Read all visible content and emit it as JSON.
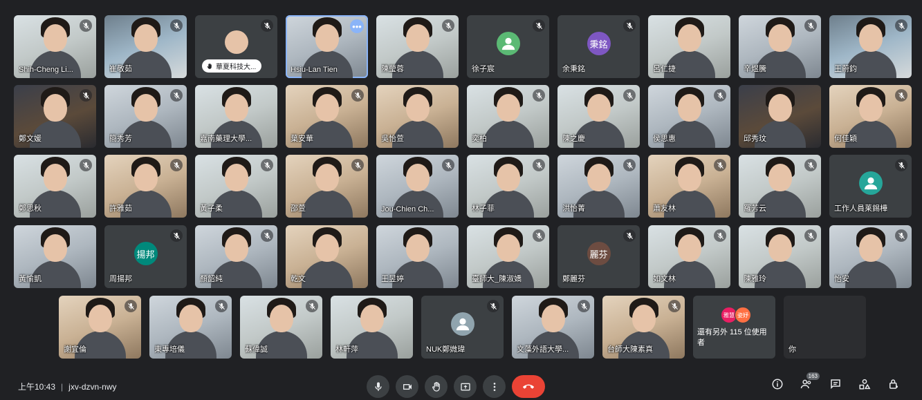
{
  "rows": [
    [
      {
        "name": "Shih-Cheng Li...",
        "type": "cam",
        "v": "v3",
        "muted": true
      },
      {
        "name": "崔敬茹",
        "type": "cam",
        "v": "v4",
        "muted": true
      },
      {
        "name": "華夏科技大...",
        "type": "pill",
        "muted": true
      },
      {
        "name": "Hsiu-Lan Tien",
        "type": "cam",
        "v": "v1",
        "muted": false,
        "active": true,
        "more": "•••"
      },
      {
        "name": "陳瑩蓉",
        "type": "cam",
        "v": "v3",
        "muted": true
      },
      {
        "name": "徐子宸",
        "type": "avatar",
        "color": "#5bb974",
        "initial": "",
        "muted": true
      },
      {
        "name": "余秉銘",
        "type": "avatar",
        "color": "#7e57c2",
        "initial": "秉銘",
        "muted": true
      },
      {
        "name": "呂仁捷",
        "type": "cam",
        "v": "v3",
        "muted": false
      },
      {
        "name": "辛煜騰",
        "type": "cam",
        "v": "v1",
        "muted": true
      },
      {
        "name": "王蔚鈞",
        "type": "cam",
        "v": "v4",
        "muted": true
      }
    ],
    [
      {
        "name": "鄭文媛",
        "type": "cam",
        "v": "v5",
        "muted": true
      },
      {
        "name": "簡秀芳",
        "type": "cam",
        "v": "v1",
        "muted": true
      },
      {
        "name": "嘉南藥理大學...",
        "type": "cam",
        "v": "v3",
        "muted": false
      },
      {
        "name": "葉安華",
        "type": "cam",
        "v": "v2",
        "muted": true
      },
      {
        "name": "吳怡萱",
        "type": "cam",
        "v": "v2",
        "muted": false
      },
      {
        "name": "奕柏",
        "type": "cam",
        "v": "v3",
        "muted": true
      },
      {
        "name": "陳之慶",
        "type": "cam",
        "v": "v3",
        "muted": true
      },
      {
        "name": "侯思惠",
        "type": "cam",
        "v": "v1",
        "muted": true
      },
      {
        "name": "邱秀玟",
        "type": "cam",
        "v": "v5",
        "muted": false
      },
      {
        "name": "何佳穎",
        "type": "cam",
        "v": "v2",
        "muted": true
      }
    ],
    [
      {
        "name": "鄭思秋",
        "type": "cam",
        "v": "v3",
        "muted": true
      },
      {
        "name": "許雅茹",
        "type": "cam",
        "v": "v2",
        "muted": true
      },
      {
        "name": "黃子柔",
        "type": "cam",
        "v": "v3",
        "muted": true
      },
      {
        "name": "邵萱",
        "type": "cam",
        "v": "v2",
        "muted": true
      },
      {
        "name": "Jou-Chien Ch...",
        "type": "cam",
        "v": "v1",
        "muted": true
      },
      {
        "name": "林子菲",
        "type": "cam",
        "v": "v3",
        "muted": true
      },
      {
        "name": "洪怡菁",
        "type": "cam",
        "v": "v1",
        "muted": true
      },
      {
        "name": "蕭友林",
        "type": "cam",
        "v": "v2",
        "muted": true
      },
      {
        "name": "羅芳云",
        "type": "cam",
        "v": "v3",
        "muted": true
      },
      {
        "name": "工作人員莱錫樺",
        "type": "avatar",
        "color": "#26a69a",
        "initial": "",
        "muted": true
      }
    ],
    [
      {
        "name": "黃愉凱",
        "type": "cam",
        "v": "v1",
        "muted": false
      },
      {
        "name": "周揚邦",
        "type": "avatar",
        "color": "#00897b",
        "initial": "揚邦",
        "muted": true
      },
      {
        "name": "顏韶純",
        "type": "cam",
        "v": "v1",
        "muted": true
      },
      {
        "name": "乾文",
        "type": "cam",
        "v": "v2",
        "muted": false
      },
      {
        "name": "王昱婷",
        "type": "cam",
        "v": "v1",
        "muted": false
      },
      {
        "name": "臺師大_陳淑嬌",
        "type": "cam",
        "v": "v3",
        "muted": true
      },
      {
        "name": "鄭麗芬",
        "type": "avatar",
        "color": "#6d4c41",
        "initial": "麗芬",
        "muted": true
      },
      {
        "name": "如文林",
        "type": "cam",
        "v": "v3",
        "muted": true
      },
      {
        "name": "陳雅玲",
        "type": "cam",
        "v": "v3",
        "muted": true
      },
      {
        "name": "怡安",
        "type": "cam",
        "v": "v1",
        "muted": true
      }
    ],
    [
      {
        "name": "謝宜倫",
        "type": "cam",
        "v": "v2",
        "muted": true
      },
      {
        "name": "東專培儀",
        "type": "cam",
        "v": "v1",
        "muted": true
      },
      {
        "name": "蘇偉誠",
        "type": "cam",
        "v": "v3",
        "muted": true
      },
      {
        "name": "林軒萍",
        "type": "cam",
        "v": "v3",
        "muted": false
      },
      {
        "name": "NUK鄭媺瑋",
        "type": "avatar",
        "color": "#90a4ae",
        "initial": "",
        "muted": true
      },
      {
        "name": "文藻外語大學...",
        "type": "cam",
        "v": "v1",
        "muted": true
      },
      {
        "name": "台師大陳素真",
        "type": "cam",
        "v": "v2",
        "muted": true
      },
      {
        "name": "還有另外 115 位使用者",
        "type": "others",
        "chips": [
          "雅慧",
          "姿妤"
        ],
        "muted": false
      },
      {
        "name": "你",
        "type": "you",
        "muted": false
      }
    ]
  ],
  "bottom": {
    "time": "上午10:43",
    "separator": "|",
    "meeting_code": "jxv-dzvn-nwy",
    "participants_count": "163"
  }
}
